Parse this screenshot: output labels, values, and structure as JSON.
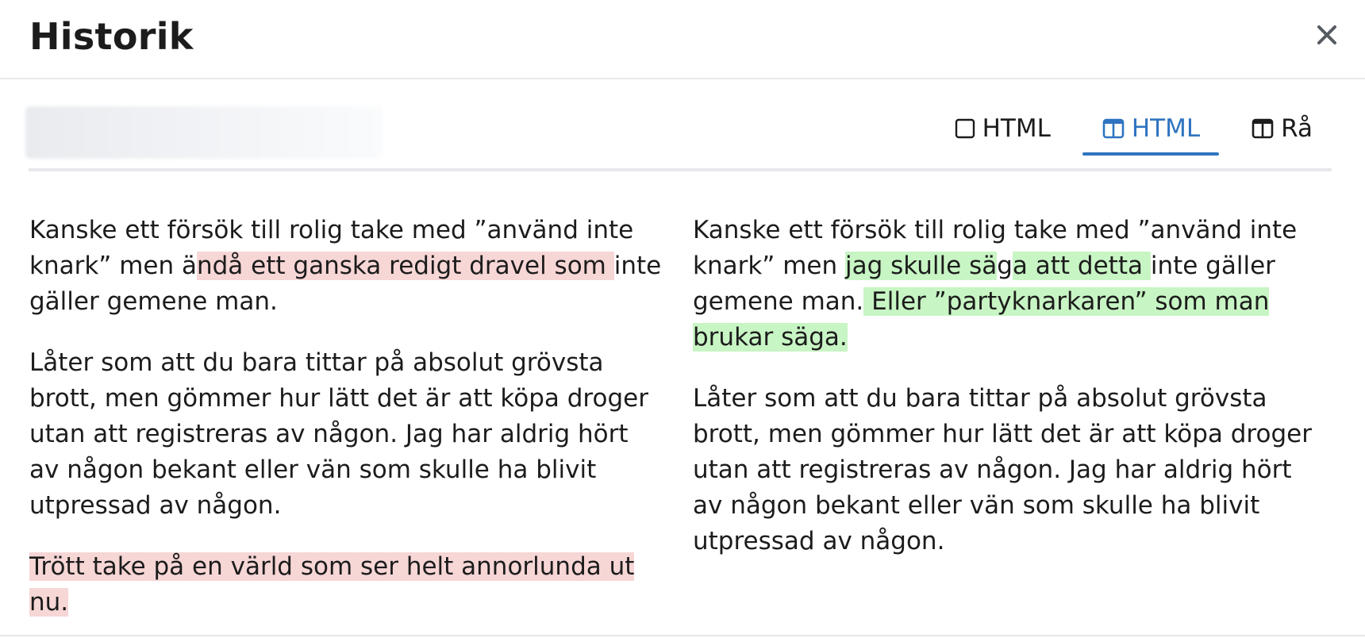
{
  "dialog": {
    "title": "Historik",
    "close_icon": "close-icon"
  },
  "toolbar": {
    "tabs": [
      {
        "label": "HTML",
        "icon": "square-icon",
        "active": false
      },
      {
        "label": "HTML",
        "icon": "split-columns-icon",
        "active": true
      },
      {
        "label": "Rå",
        "icon": "split-columns-icon",
        "active": false
      }
    ],
    "accent_color": "#2f74c0"
  },
  "diff": {
    "left": {
      "p1_a": "Kanske ett försök till rolig take med ”använd inte knark” men ä",
      "p1_del": "ndå ett ganska redigt dravel som ",
      "p1_b": "inte gäller gemene man.",
      "p2": "Låter som att du bara tittar på absolut grövsta brott, men gömmer hur lätt det är att köpa droger utan att registreras av någon. Jag har aldrig hört av någon bekant eller vän som skulle ha blivit utpressad av någon.",
      "p3_del": "Trött take på en värld som ser helt annorlunda ut nu. "
    },
    "right": {
      "p1_a": "Kanske ett försök till rolig take med ”använd inte knark” men ",
      "p1_ins1": "jag skulle sä",
      "p1_b": "g",
      "p1_ins2": "a att detta ",
      "p1_c": "inte gäller gemene man.",
      "p1_ins3": " Eller ”partyknarkaren” som man brukar säga.",
      "p2": "Låter som att du bara tittar på absolut grövsta brott, men gömmer hur lätt det är att köpa droger utan att registreras av någon. Jag har aldrig hört av någon bekant eller vän som skulle ha blivit utpressad av någon."
    },
    "colors": {
      "deleted_bg": "#f7d6d6",
      "inserted_bg": "#c8f5c4"
    }
  }
}
